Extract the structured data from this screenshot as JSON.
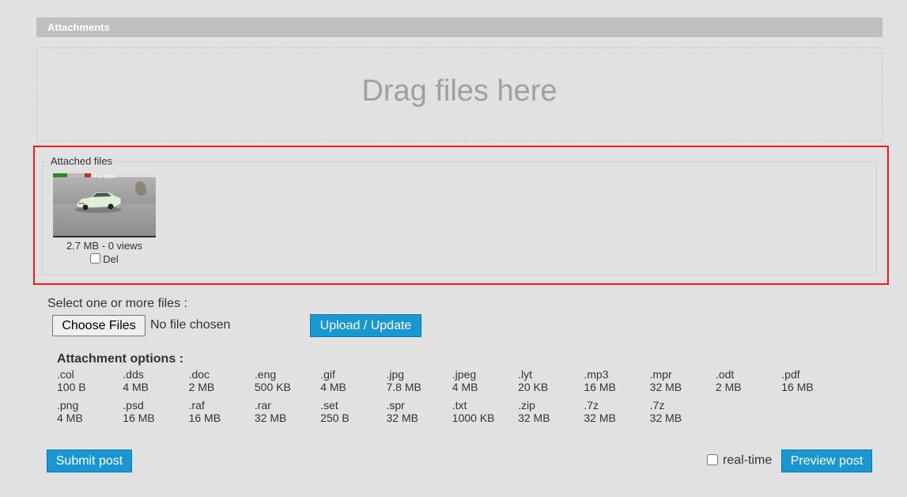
{
  "attachments_header": "Attachments",
  "dropzone": {
    "text": "Drag files here"
  },
  "attached_files": {
    "legend": "Attached files",
    "files": [
      {
        "meta": "2.7 MB - 0 views",
        "delete_label": "Del",
        "delete_checked": false,
        "thumbnail_tag": "FC kiss"
      }
    ]
  },
  "upload": {
    "select_label": "Select one or more files :",
    "choose_button": "Choose Files",
    "no_file_text": "No file chosen",
    "upload_button": "Upload / Update"
  },
  "attachment_options": {
    "title": "Attachment options :",
    "rows": [
      [
        {
          "ext": ".col",
          "size": "100 B"
        },
        {
          "ext": ".dds",
          "size": "4 MB"
        },
        {
          "ext": ".doc",
          "size": "2 MB"
        },
        {
          "ext": ".eng",
          "size": "500 KB"
        },
        {
          "ext": ".gif",
          "size": "4 MB"
        },
        {
          "ext": ".jpg",
          "size": "7.8 MB"
        },
        {
          "ext": ".jpeg",
          "size": "4 MB"
        },
        {
          "ext": ".lyt",
          "size": "20 KB"
        },
        {
          "ext": ".mp3",
          "size": "16 MB"
        },
        {
          "ext": ".mpr",
          "size": "32 MB"
        },
        {
          "ext": ".odt",
          "size": "2 MB"
        },
        {
          "ext": ".pdf",
          "size": "16 MB"
        }
      ],
      [
        {
          "ext": ".png",
          "size": "4 MB"
        },
        {
          "ext": ".psd",
          "size": "16 MB"
        },
        {
          "ext": ".raf",
          "size": "16 MB"
        },
        {
          "ext": ".rar",
          "size": "32 MB"
        },
        {
          "ext": ".set",
          "size": "250 B"
        },
        {
          "ext": ".spr",
          "size": "32 MB"
        },
        {
          "ext": ".txt",
          "size": "1000 KB"
        },
        {
          "ext": ".zip",
          "size": "32 MB"
        },
        {
          "ext": ".7z",
          "size": "32 MB"
        },
        {
          "ext": ".7z",
          "size": "32 MB"
        }
      ]
    ]
  },
  "footer": {
    "submit_button": "Submit post",
    "realtime_label": "real-time",
    "realtime_checked": false,
    "preview_button": "Preview post"
  },
  "colors": {
    "accent": "#1a97d0",
    "highlight_border": "#ee1c1c",
    "header_bg": "#bfbfbf",
    "page_bg": "#e1e1e2"
  }
}
